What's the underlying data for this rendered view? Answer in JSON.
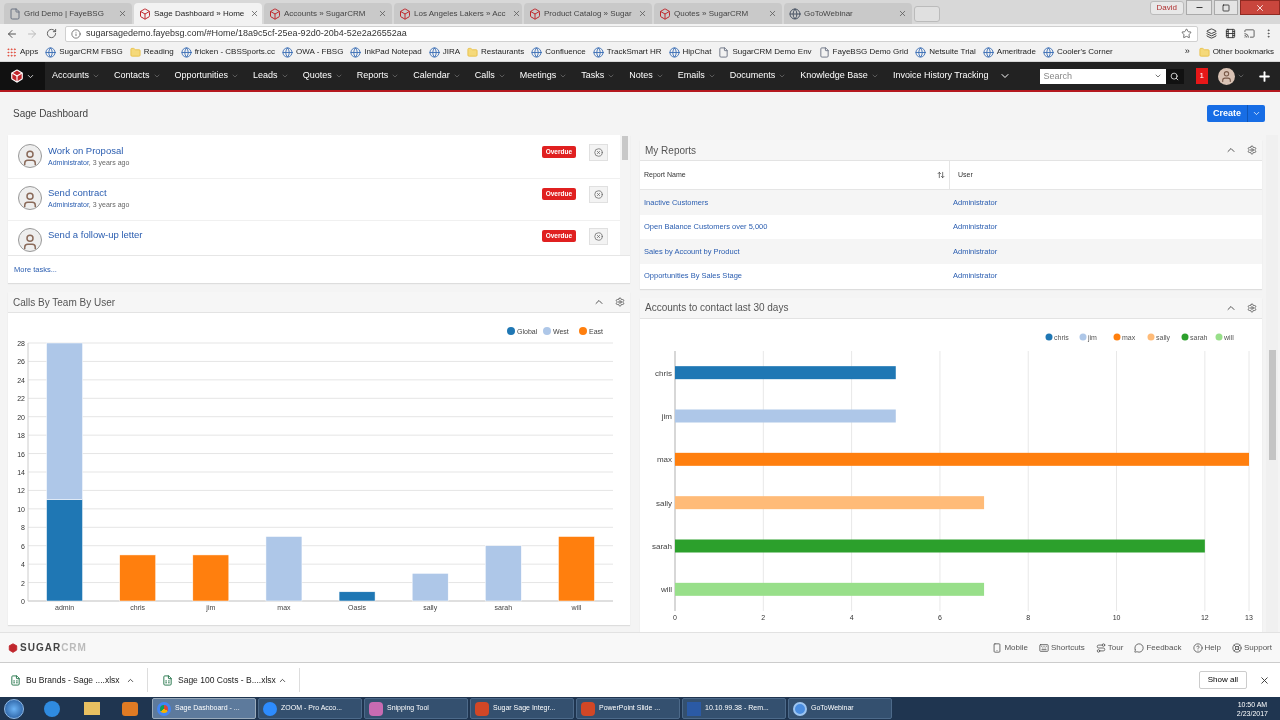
{
  "browser": {
    "tabs": [
      {
        "title": "Grid Demo | FayeBSG",
        "kind": "page",
        "selected": false
      },
      {
        "title": "Sage Dashboard » Home",
        "kind": "sugar",
        "selected": true
      },
      {
        "title": "Accounts » SugarCRM",
        "kind": "sugar",
        "selected": false
      },
      {
        "title": "Los Angeles Lakers » Acc",
        "kind": "sugar",
        "selected": false
      },
      {
        "title": "Product Catalog » Sugar",
        "kind": "sugar",
        "selected": false
      },
      {
        "title": "Quotes » SugarCRM",
        "kind": "sugar",
        "selected": false
      },
      {
        "title": "GoToWebinar",
        "kind": "webinar",
        "selected": false
      }
    ],
    "profile": "David",
    "url": "sugarsagedemo.fayebsg.com/#Home/18a9c5cf-25ea-92d0-20b4-52e2a26552aa",
    "bookmarks": [
      {
        "label": "Apps",
        "kind": "apps"
      },
      {
        "label": "SugarCRM FBSG",
        "kind": "site"
      },
      {
        "label": "Reading",
        "kind": "folder"
      },
      {
        "label": "fricken - CBSSports.cc",
        "kind": "site"
      },
      {
        "label": "OWA - FBSG",
        "kind": "site"
      },
      {
        "label": "InkPad Notepad",
        "kind": "site"
      },
      {
        "label": "JIRA",
        "kind": "site"
      },
      {
        "label": "Restaurants",
        "kind": "folder"
      },
      {
        "label": "Confluence",
        "kind": "site"
      },
      {
        "label": "TrackSmart HR",
        "kind": "site"
      },
      {
        "label": "HipChat",
        "kind": "site"
      },
      {
        "label": "SugarCRM Demo Env",
        "kind": "page"
      },
      {
        "label": "FayeBSG Demo Grid",
        "kind": "page"
      },
      {
        "label": "Netsuite Trial",
        "kind": "site"
      },
      {
        "label": "Ameritrade",
        "kind": "site"
      },
      {
        "label": "Cooler's Corner",
        "kind": "site"
      }
    ],
    "more_bookmarks": "»",
    "other_bookmarks": "Other bookmarks"
  },
  "nav": {
    "items": [
      "Accounts",
      "Contacts",
      "Opportunities",
      "Leads",
      "Quotes",
      "Reports",
      "Calendar",
      "Calls",
      "Meetings",
      "Tasks",
      "Notes",
      "Emails",
      "Documents",
      "Knowledge Base",
      "Invoice History Tracking"
    ],
    "search": {
      "placeholder": "Search"
    },
    "notifications": "1"
  },
  "header": {
    "title": "Sage Dashboard",
    "create": "Create"
  },
  "tasks": {
    "items": [
      {
        "title": "Work on Proposal",
        "user": "Administrator",
        "when": ", 3 years ago",
        "badge": "Overdue"
      },
      {
        "title": "Send contract",
        "user": "Administrator",
        "when": ", 3 years ago",
        "badge": "Overdue"
      },
      {
        "title": "Send a follow-up letter",
        "badge": "Overdue"
      }
    ],
    "more": "More tasks..."
  },
  "calls_chart": {
    "title": "Calls By Team By User",
    "chart_data": {
      "type": "bar",
      "stacked": true,
      "orientation": "vertical",
      "categories": [
        "admin",
        "chris",
        "jim",
        "max",
        "Oasis",
        "sally",
        "sarah",
        "will"
      ],
      "series": [
        {
          "name": "Global",
          "color": "#1f77b4",
          "values": [
            11,
            null,
            null,
            null,
            1,
            null,
            null,
            null
          ]
        },
        {
          "name": "West",
          "color": "#aec7e8",
          "values": [
            17,
            null,
            null,
            7,
            null,
            3,
            6,
            null
          ]
        },
        {
          "name": "East",
          "color": "#ff7f0e",
          "values": [
            null,
            5,
            5,
            null,
            null,
            null,
            null,
            7
          ]
        }
      ],
      "ylim": [
        0,
        28
      ],
      "yticks": [
        0,
        2,
        4,
        6,
        8,
        10,
        12,
        14,
        16,
        18,
        20,
        22,
        24,
        26,
        28
      ],
      "grid": true,
      "legend": "top-right"
    }
  },
  "reports": {
    "title": "My Reports",
    "columns": [
      "Report Name",
      "User"
    ],
    "rows": [
      [
        "Inactive Customers",
        "Administrator"
      ],
      [
        "Open Balance Customers over 5,000",
        "Administrator"
      ],
      [
        "Sales by Account by Product",
        "Administrator"
      ],
      [
        "Opportunities By Sales Stage",
        "Administrator"
      ]
    ]
  },
  "accounts_chart": {
    "title": "Accounts to contact last 30 days",
    "chart_data": {
      "type": "bar",
      "orientation": "horizontal",
      "categories": [
        "chris",
        "jim",
        "max",
        "sally",
        "sarah",
        "will"
      ],
      "series": [
        {
          "name": "chris",
          "color": "#1f77b4",
          "values": [
            5,
            null,
            null,
            null,
            null,
            null
          ]
        },
        {
          "name": "jim",
          "color": "#aec7e8",
          "values": [
            null,
            5,
            null,
            null,
            null,
            null
          ]
        },
        {
          "name": "max",
          "color": "#ff7f0e",
          "values": [
            null,
            null,
            13,
            null,
            null,
            null
          ]
        },
        {
          "name": "sally",
          "color": "#ffbb78",
          "values": [
            null,
            null,
            null,
            7,
            null,
            null
          ]
        },
        {
          "name": "sarah",
          "color": "#2ca02c",
          "values": [
            null,
            null,
            null,
            null,
            12,
            null
          ]
        },
        {
          "name": "will",
          "color": "#98df8a",
          "values": [
            null,
            null,
            null,
            null,
            null,
            7
          ]
        }
      ],
      "xlim": [
        0,
        13
      ],
      "xticks": [
        0,
        2,
        4,
        6,
        8,
        10,
        12,
        13
      ],
      "grid": true,
      "legend": "top-right"
    }
  },
  "footer": {
    "logo_bold": "SUGAR",
    "logo_light": "CRM",
    "links": [
      {
        "label": "Mobile",
        "kind": "mobile"
      },
      {
        "label": "Shortcuts",
        "kind": "shortcuts"
      },
      {
        "label": "Tour",
        "kind": "tour"
      },
      {
        "label": "Feedback",
        "kind": "feedback"
      },
      {
        "label": "Help",
        "kind": "help"
      },
      {
        "label": "Support",
        "kind": "support"
      }
    ]
  },
  "downloads": {
    "files": [
      "Bu Brands - Sage ....xlsx",
      "Sage 100 Costs - B....xlsx"
    ],
    "show_all": "Show all"
  },
  "taskbar": {
    "apps": [
      {
        "label": "Sage Dashboard - ...",
        "kind": "chrome",
        "selected": true
      },
      {
        "label": "ZOOM - Pro Acco...",
        "kind": "zoom",
        "selected": false
      },
      {
        "label": "Snipping Tool",
        "kind": "snip",
        "selected": false
      },
      {
        "label": "Sugar Sage Integr...",
        "kind": "ppt",
        "selected": false
      },
      {
        "label": "PowerPoint Slide ...",
        "kind": "ppt",
        "selected": false
      },
      {
        "label": "10.10.99.38 - Rem...",
        "kind": "remote",
        "selected": false
      },
      {
        "label": "GoToWebinar",
        "kind": "webinar",
        "selected": false
      }
    ],
    "time": "10:50 AM",
    "date": "2/23/2017"
  }
}
